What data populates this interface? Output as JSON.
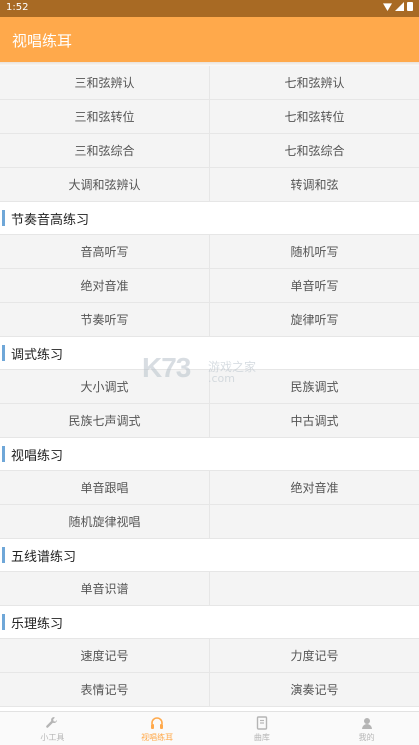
{
  "status_bar": {
    "time": "1:52"
  },
  "app_bar": {
    "title": "视唱练耳"
  },
  "sections": [
    {
      "title": "",
      "rows": [
        [
          "三和弦辨认",
          "七和弦辨认"
        ],
        [
          "三和弦转位",
          "七和弦转位"
        ],
        [
          "三和弦综合",
          "七和弦综合"
        ],
        [
          "大调和弦辨认",
          "转调和弦"
        ]
      ]
    },
    {
      "title": "节奏音高练习",
      "rows": [
        [
          "音高听写",
          "随机听写"
        ],
        [
          "绝对音准",
          "单音听写"
        ],
        [
          "节奏听写",
          "旋律听写"
        ]
      ]
    },
    {
      "title": "调式练习",
      "rows": [
        [
          "大小调式",
          "民族调式"
        ],
        [
          "民族七声调式",
          "中古调式"
        ]
      ]
    },
    {
      "title": "视唱练习",
      "rows": [
        [
          "单音跟唱",
          "绝对音准"
        ],
        [
          "随机旋律视唱",
          ""
        ]
      ]
    },
    {
      "title": "五线谱练习",
      "rows": [
        [
          "单音识谱",
          ""
        ]
      ]
    },
    {
      "title": "乐理练习",
      "rows": [
        [
          "速度记号",
          "力度记号"
        ],
        [
          "表情记号",
          "演奏记号"
        ]
      ]
    }
  ],
  "watermark": {
    "logo": "K73",
    "text": "游戏之家",
    "domain": ".com"
  },
  "bottom_nav": [
    {
      "label": "小工具",
      "icon": "wrench-icon",
      "active": false
    },
    {
      "label": "视唱练耳",
      "icon": "headphones-icon",
      "active": true
    },
    {
      "label": "曲库",
      "icon": "book-icon",
      "active": false
    },
    {
      "label": "我的",
      "icon": "user-icon",
      "active": false
    }
  ],
  "colors": {
    "accent": "#ffa94b",
    "status_bar": "#a86a24",
    "section_bar": "#6fa7d8"
  }
}
